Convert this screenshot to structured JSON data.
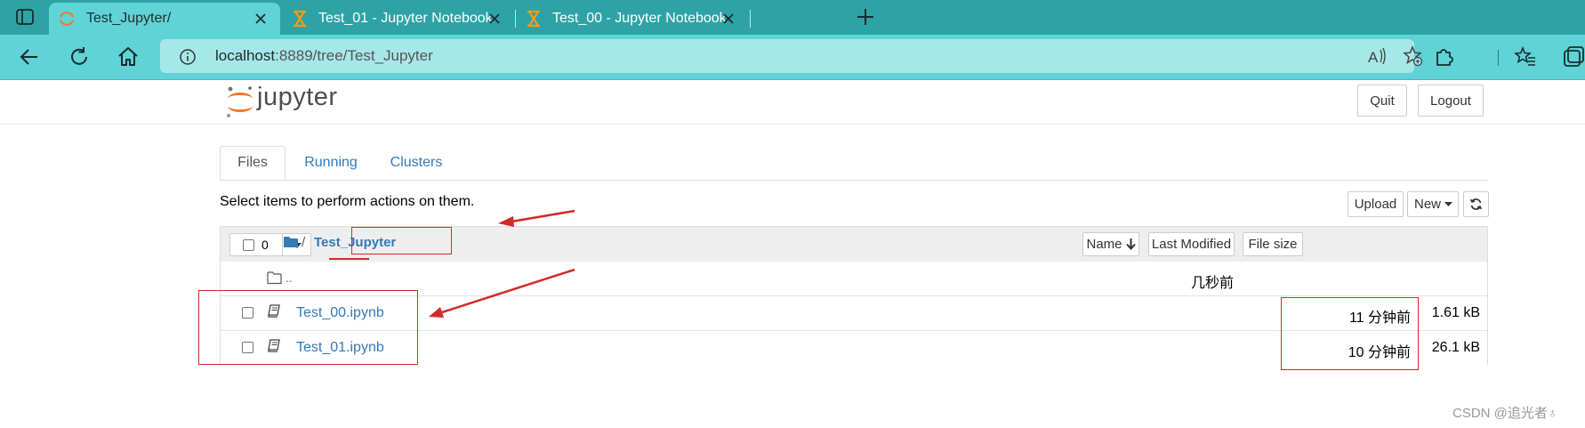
{
  "browser": {
    "tabs": [
      {
        "title": "Test_Jupyter/",
        "active": true,
        "icon": "jupyter-spinner-icon"
      },
      {
        "title": "Test_01 - Jupyter Notebook",
        "active": false,
        "icon": "hourglass-icon"
      },
      {
        "title": "Test_00 - Jupyter Notebook",
        "active": false,
        "icon": "hourglass-icon"
      }
    ],
    "url": {
      "host": "localhost",
      "rest": ":8889/tree/Test_Jupyter"
    },
    "colors": {
      "tabstrip": "#2ea3a6",
      "active_tab": "#5fd3d6",
      "urlbar": "#a6e8ea"
    }
  },
  "jupyter": {
    "logo_text": "jupyter",
    "quit_label": "Quit",
    "logout_label": "Logout",
    "tabs": [
      "Files",
      "Running",
      "Clusters"
    ],
    "select_hint": "Select items to perform actions on them.",
    "upload_label": "Upload",
    "new_label": "New",
    "selected_count": "0",
    "breadcrumb_sep": "/",
    "breadcrumb_current": "Test_Jupyter",
    "columns": {
      "name": "Name",
      "last_modified": "Last Modified",
      "file_size": "File size"
    },
    "parent_row": {
      "name": "..",
      "modified": "几秒前"
    },
    "files": [
      {
        "name": "Test_00.ipynb",
        "modified": "11 分钟前",
        "size": "1.61 kB"
      },
      {
        "name": "Test_01.ipynb",
        "modified": "10 分钟前",
        "size": "26.1 kB"
      }
    ],
    "colors": {
      "link": "#337ab7",
      "logo_orange": "#f37726",
      "annotation_red": "#d22a2a"
    }
  },
  "watermark": "CSDN @追光者♁"
}
